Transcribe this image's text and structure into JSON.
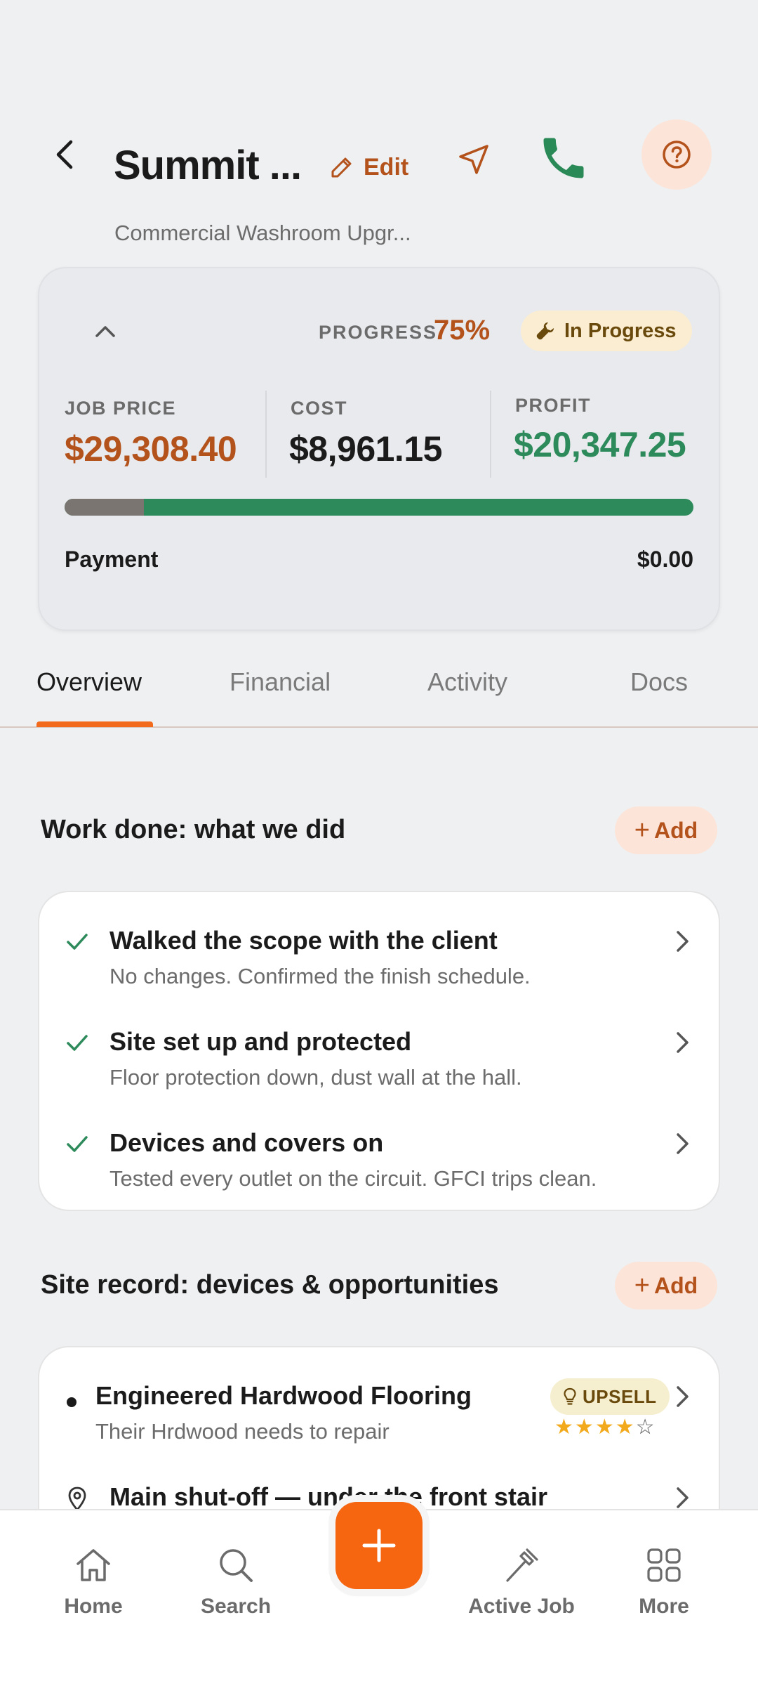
{
  "header": {
    "title": "Summit ...",
    "subtitle": "Commercial Washroom Upgr...",
    "edit_label": "Edit"
  },
  "summary": {
    "progress_label": "PROGRESS",
    "progress_value": "75%",
    "status": "In Progress",
    "job_price_label": "JOB PRICE",
    "job_price": "$29,308.40",
    "cost_label": "COST",
    "cost": "$8,961.15",
    "profit_label": "PROFIT",
    "profit": "$20,347.25",
    "cost_fraction": 0.1257,
    "payment_label": "Payment",
    "payment_value": "$0.00"
  },
  "tabs": [
    {
      "label": "Overview",
      "active": true
    },
    {
      "label": "Financial",
      "active": false
    },
    {
      "label": "Activity",
      "active": false
    },
    {
      "label": "Docs",
      "active": false
    }
  ],
  "work_done": {
    "title": "Work done: what we did",
    "add_label": "Add",
    "items": [
      {
        "title": "Walked the scope with the client",
        "sub": "No changes. Confirmed the finish schedule."
      },
      {
        "title": "Site set up and protected",
        "sub": "Floor protection down, dust wall at the hall."
      },
      {
        "title": "Devices and covers on",
        "sub": "Tested every outlet on the circuit. GFCI trips clean."
      }
    ]
  },
  "site_record": {
    "title": "Site record: devices & opportunities",
    "add_label": "Add",
    "items": [
      {
        "title": "Engineered Hardwood Flooring",
        "sub": "Their Hrdwood needs to repair",
        "badge": "UPSELL",
        "rating": 4,
        "rating_max": 5
      },
      {
        "title": "Main shut-off — under the front stair"
      }
    ]
  },
  "bottom_nav": {
    "home": "Home",
    "search": "Search",
    "active_job": "Active Job",
    "more": "More"
  },
  "colors": {
    "accent": "#f6650f",
    "accent_text": "#b4521c",
    "profit": "#2d8a5a",
    "call": "#2a8a57"
  }
}
